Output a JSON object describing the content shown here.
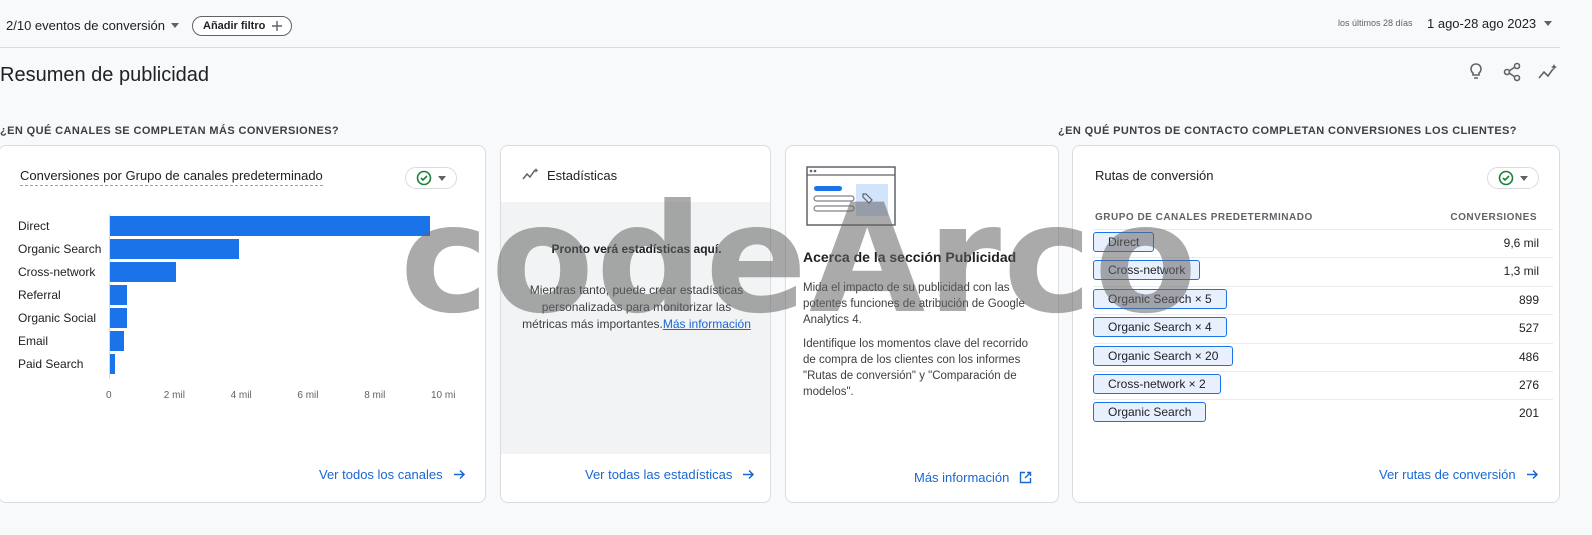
{
  "topbar": {
    "events": "2/10 eventos de conversión",
    "add_filter": "Añadir filtro",
    "range_label": "los últimos 28 días",
    "range_value": "1 ago-28 ago 2023"
  },
  "page_title": "Resumen de publicidad",
  "sections": {
    "channels_question": "¿EN QUÉ CANALES SE COMPLETAN MÁS CONVERSIONES?",
    "touchpoints_question": "¿EN QUÉ PUNTOS DE CONTACTO COMPLETAN CONVERSIONES LOS CLIENTES?"
  },
  "channels_card": {
    "title": "Conversiones por Grupo de canales predeterminado",
    "link": "Ver todos los canales"
  },
  "chart_data": {
    "type": "bar",
    "orientation": "horizontal",
    "categories": [
      "Direct",
      "Organic Search",
      "Cross-network",
      "Referral",
      "Organic Social",
      "Email",
      "Paid Search"
    ],
    "values": [
      9600,
      3900,
      2000,
      550,
      530,
      450,
      180
    ],
    "xlim": [
      0,
      10000
    ],
    "ticks": [
      "0",
      "2 mil",
      "4 mil",
      "6 mil",
      "8 mil",
      "10 mi"
    ],
    "bar_color": "#1a73e8"
  },
  "stats_card": {
    "title": "Estadísticas",
    "heading": "Pronto verá estadísticas aquí.",
    "body": "Mientras tanto, puede crear estadísticas personalizadas para monitorizar las métricas más importantes.",
    "inline_link": "Más información",
    "link": "Ver todas las estadísticas"
  },
  "about_card": {
    "title": "Acerca de la sección Publicidad",
    "p1": "Mida el impacto de su publicidad con las potentes funciones de atribución de Google Analytics 4.",
    "p2": "Identifique los momentos clave del recorrido de compra de los clientes con los informes \"Rutas de conversión\" y \"Comparación de modelos\".",
    "link": "Más información"
  },
  "paths_card": {
    "title": "Rutas de conversión",
    "col1": "GRUPO DE CANALES PREDETERMINADO",
    "col2": "CONVERSIONES",
    "rows": [
      {
        "path": "Direct",
        "value": "9,6 mil"
      },
      {
        "path": "Cross-network",
        "value": "1,3 mil"
      },
      {
        "path": "Organic Search × 5",
        "value": "899"
      },
      {
        "path": "Organic Search × 4",
        "value": "527"
      },
      {
        "path": "Organic Search × 20",
        "value": "486"
      },
      {
        "path": "Cross-network × 2",
        "value": "276"
      },
      {
        "path": "Organic Search",
        "value": "201"
      }
    ],
    "link": "Ver rutas de conversión"
  },
  "watermark": "codeArco",
  "colors": {
    "accent": "#1a73e8",
    "link": "#1967d2",
    "check": "#188038"
  }
}
